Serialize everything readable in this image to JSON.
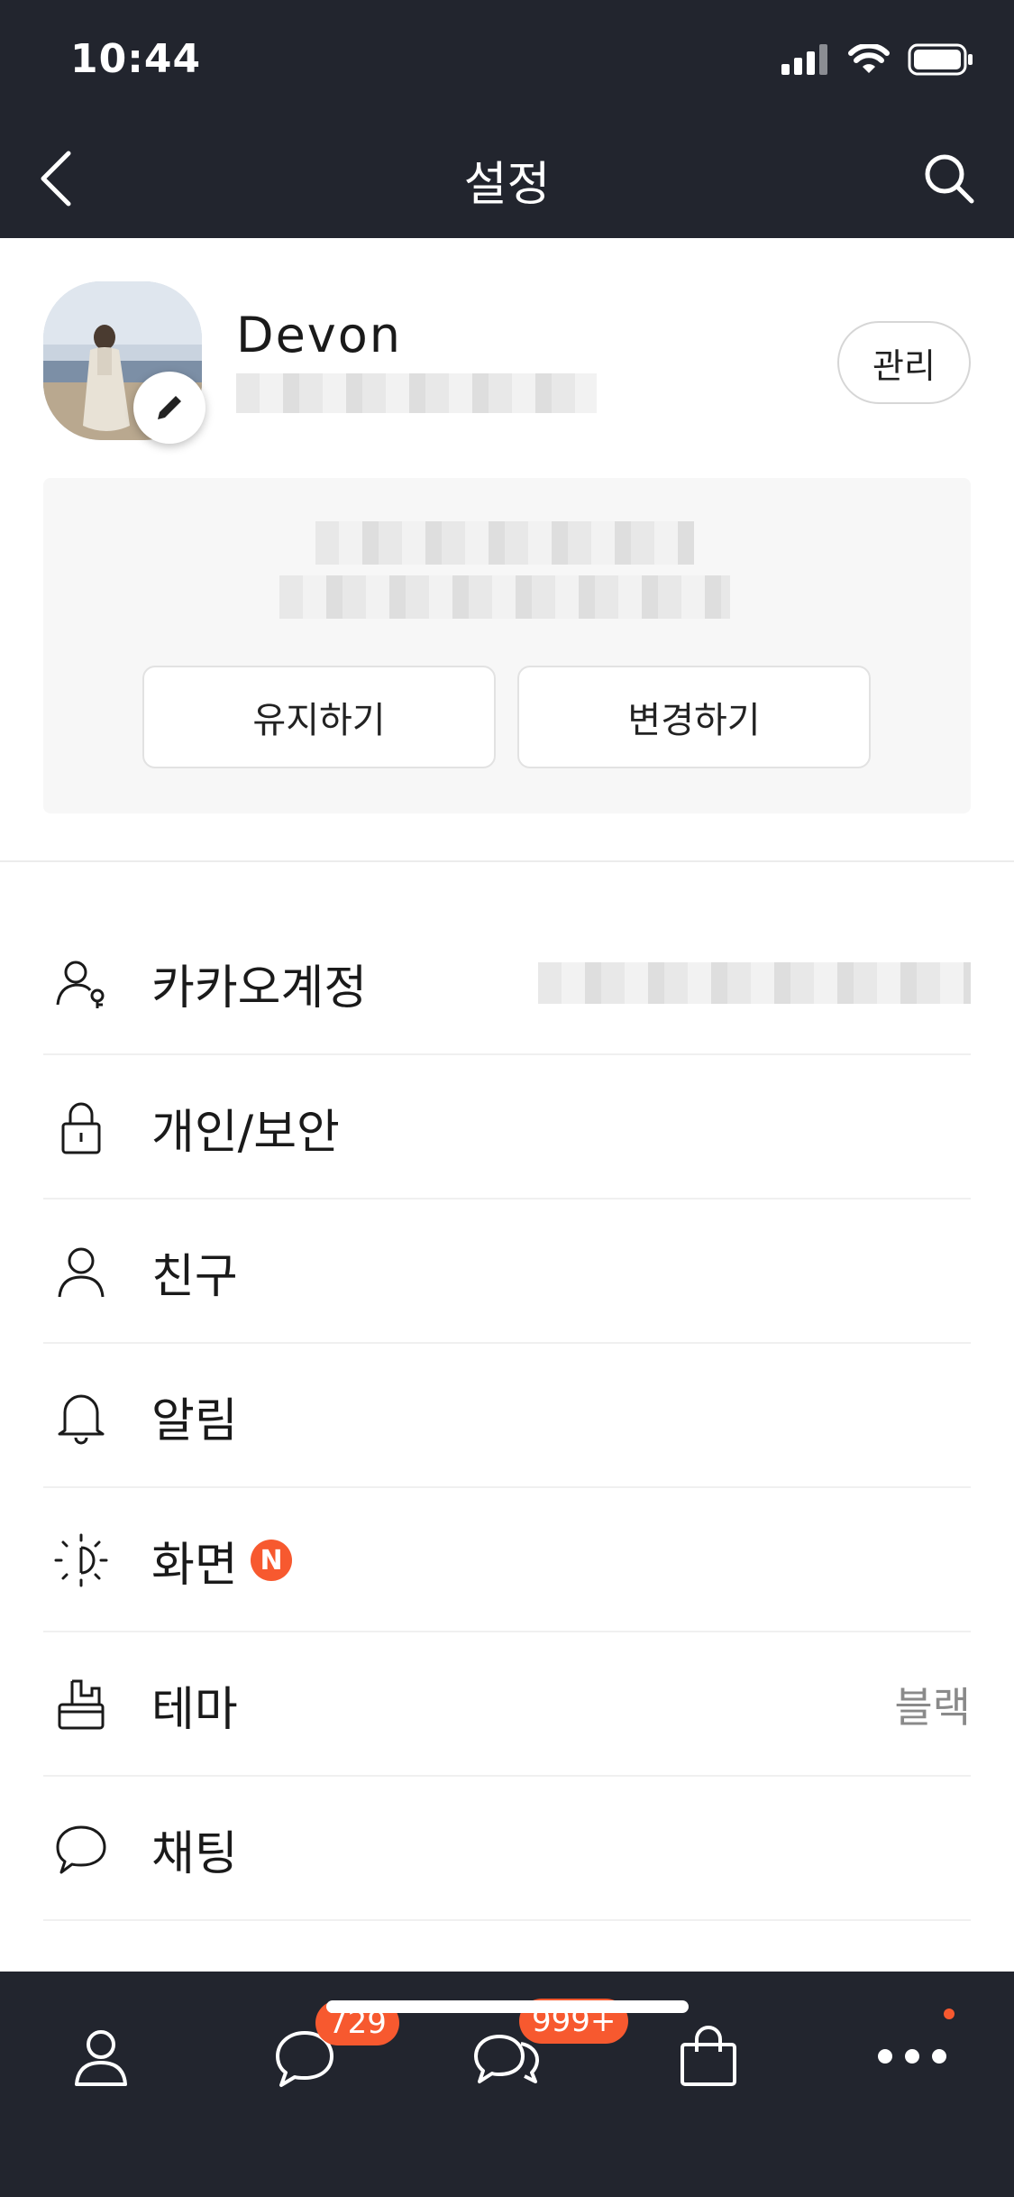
{
  "status_bar": {
    "time": "10:44"
  },
  "nav": {
    "title": "설정",
    "back_icon": "chevron-left-icon",
    "search_icon": "search-icon"
  },
  "profile": {
    "name": "Devon",
    "manage_label": "관리"
  },
  "notice": {
    "keep_label": "유지하기",
    "change_label": "변경하기"
  },
  "menu": {
    "items": [
      {
        "label": "카카오계정",
        "icon": "account-key-icon",
        "value": ""
      },
      {
        "label": "개인/보안",
        "icon": "lock-icon",
        "value": ""
      },
      {
        "label": "친구",
        "icon": "person-icon",
        "value": ""
      },
      {
        "label": "알림",
        "icon": "bell-icon",
        "value": ""
      },
      {
        "label": "화면",
        "icon": "brightness-icon",
        "value": "",
        "badge": "N"
      },
      {
        "label": "테마",
        "icon": "paint-brush-icon",
        "value": "블랙"
      },
      {
        "label": "채팅",
        "icon": "chat-bubble-icon",
        "value": ""
      }
    ]
  },
  "tabbar": {
    "chats_badge": "729",
    "openchat_badge": "999+"
  },
  "colors": {
    "dark": "#22252e",
    "accent": "#f7592f"
  }
}
